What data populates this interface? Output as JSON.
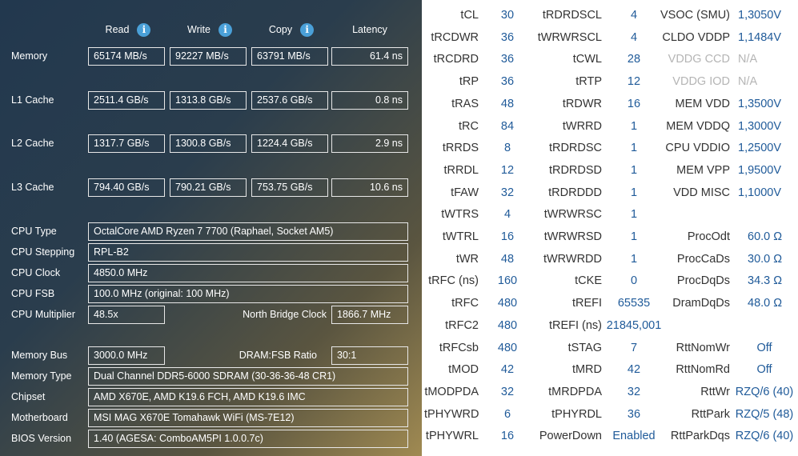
{
  "benchmark": {
    "headers": {
      "read": "Read",
      "write": "Write",
      "copy": "Copy",
      "latency": "Latency"
    },
    "info_glyph": "i",
    "rows": [
      {
        "label": "Memory",
        "read": "65174 MB/s",
        "write": "92227 MB/s",
        "copy": "63791 MB/s",
        "latency": "61.4 ns"
      },
      {
        "label": "L1 Cache",
        "read": "2511.4 GB/s",
        "write": "1313.8 GB/s",
        "copy": "2537.6 GB/s",
        "latency": "0.8 ns"
      },
      {
        "label": "L2 Cache",
        "read": "1317.7 GB/s",
        "write": "1300.8 GB/s",
        "copy": "1224.4 GB/s",
        "latency": "2.9 ns"
      },
      {
        "label": "L3 Cache",
        "read": "794.40 GB/s",
        "write": "790.21 GB/s",
        "copy": "753.75 GB/s",
        "latency": "10.6 ns"
      }
    ]
  },
  "cpu": {
    "type_label": "CPU Type",
    "type_value": "OctalCore AMD Ryzen 7 7700  (Raphael, Socket AM5)",
    "stepping_label": "CPU Stepping",
    "stepping_value": "RPL-B2",
    "clock_label": "CPU Clock",
    "clock_value": "4850.0 MHz",
    "fsb_label": "CPU FSB",
    "fsb_value": "100.0 MHz  (original: 100 MHz)",
    "multiplier_label": "CPU Multiplier",
    "multiplier_value": "48.5x",
    "nb_clock_label": "North Bridge Clock",
    "nb_clock_value": "1866.7 MHz"
  },
  "memory": {
    "bus_label": "Memory Bus",
    "bus_value": "3000.0 MHz",
    "ratio_label": "DRAM:FSB Ratio",
    "ratio_value": "30:1",
    "type_label": "Memory Type",
    "type_value": "Dual Channel DDR5-6000 SDRAM  (30-36-36-48 CR1)",
    "chipset_label": "Chipset",
    "chipset_value": "AMD X670E, AMD K19.6 FCH, AMD K19.6 IMC",
    "motherboard_label": "Motherboard",
    "motherboard_value": "MSI MAG X670E Tomahawk WiFi (MS-7E12)",
    "bios_label": "BIOS Version",
    "bios_value": "1.40  (AGESA: ComboAM5PI 1.0.0.7c)"
  },
  "timings": {
    "col1": [
      {
        "label": "tCL",
        "value": "30"
      },
      {
        "label": "tRCDWR",
        "value": "36"
      },
      {
        "label": "tRCDRD",
        "value": "36"
      },
      {
        "label": "tRP",
        "value": "36"
      },
      {
        "label": "tRAS",
        "value": "48"
      },
      {
        "label": "tRC",
        "value": "84"
      },
      {
        "label": "tRRDS",
        "value": "8"
      },
      {
        "label": "tRRDL",
        "value": "12"
      },
      {
        "label": "tFAW",
        "value": "32"
      },
      {
        "label": "tWTRS",
        "value": "4"
      },
      {
        "label": "tWTRL",
        "value": "16"
      },
      {
        "label": "tWR",
        "value": "48"
      },
      {
        "label": "tRFC (ns)",
        "value": "160"
      },
      {
        "label": "tRFC",
        "value": "480"
      },
      {
        "label": "tRFC2",
        "value": "480"
      },
      {
        "label": "tRFCsb",
        "value": "480"
      },
      {
        "label": "tMOD",
        "value": "42"
      },
      {
        "label": "tMODPDA",
        "value": "32"
      },
      {
        "label": "tPHYWRD",
        "value": "6"
      },
      {
        "label": "tPHYWRL",
        "value": "16"
      }
    ],
    "col2": [
      {
        "label": "tRDRDSCL",
        "value": "4"
      },
      {
        "label": "tWRWRSCL",
        "value": "4"
      },
      {
        "label": "tCWL",
        "value": "28"
      },
      {
        "label": "tRTP",
        "value": "12"
      },
      {
        "label": "tRDWR",
        "value": "16"
      },
      {
        "label": "tWRRD",
        "value": "1"
      },
      {
        "label": "tRDRDSC",
        "value": "1"
      },
      {
        "label": "tRDRDSD",
        "value": "1"
      },
      {
        "label": "tRDRDDD",
        "value": "1"
      },
      {
        "label": "tWRWRSC",
        "value": "1"
      },
      {
        "label": "tWRWRSD",
        "value": "1"
      },
      {
        "label": "tWRWRDD",
        "value": "1"
      },
      {
        "label": "tCKE",
        "value": "0"
      },
      {
        "label": "tREFI",
        "value": "65535"
      },
      {
        "label": "tREFI (ns)",
        "value": "21845,001"
      },
      {
        "label": "tSTAG",
        "value": "7"
      },
      {
        "label": "tMRD",
        "value": "42"
      },
      {
        "label": "tMRDPDA",
        "value": "32"
      },
      {
        "label": "tPHYRDL",
        "value": "36"
      },
      {
        "label": "PowerDown",
        "value": "Enabled"
      }
    ],
    "voltages": [
      {
        "label": "VSOC (SMU)",
        "value": "1,3050V"
      },
      {
        "label": "CLDO VDDP",
        "value": "1,1484V"
      },
      {
        "label": "VDDG CCD",
        "value": "N/A"
      },
      {
        "label": "VDDG IOD",
        "value": "N/A"
      },
      {
        "label": "MEM VDD",
        "value": "1,3500V"
      },
      {
        "label": "MEM VDDQ",
        "value": "1,3000V"
      },
      {
        "label": "CPU VDDIO",
        "value": "1,2500V"
      },
      {
        "label": "MEM VPP",
        "value": "1,9500V"
      },
      {
        "label": "VDD MISC",
        "value": "1,1000V"
      }
    ],
    "impedance": [
      {
        "label": "ProcOdt",
        "value": "60.0 Ω"
      },
      {
        "label": "ProcCaDs",
        "value": "30.0 Ω"
      },
      {
        "label": "ProcDqDs",
        "value": "34.3 Ω"
      },
      {
        "label": "DramDqDs",
        "value": "48.0 Ω"
      }
    ],
    "termination": [
      {
        "label": "RttNomWr",
        "value": "Off"
      },
      {
        "label": "RttNomRd",
        "value": "Off"
      },
      {
        "label": "RttWr",
        "value": "RZQ/6 (40)"
      },
      {
        "label": "RttPark",
        "value": "RZQ/5 (48)"
      },
      {
        "label": "RttParkDqs",
        "value": "RZQ/6 (40)"
      }
    ]
  },
  "colors": {
    "value_blue": "#1f5a99",
    "label_gray": "#333333",
    "na_gray": "#b5b5b5",
    "panel_dark": "#22384e"
  }
}
